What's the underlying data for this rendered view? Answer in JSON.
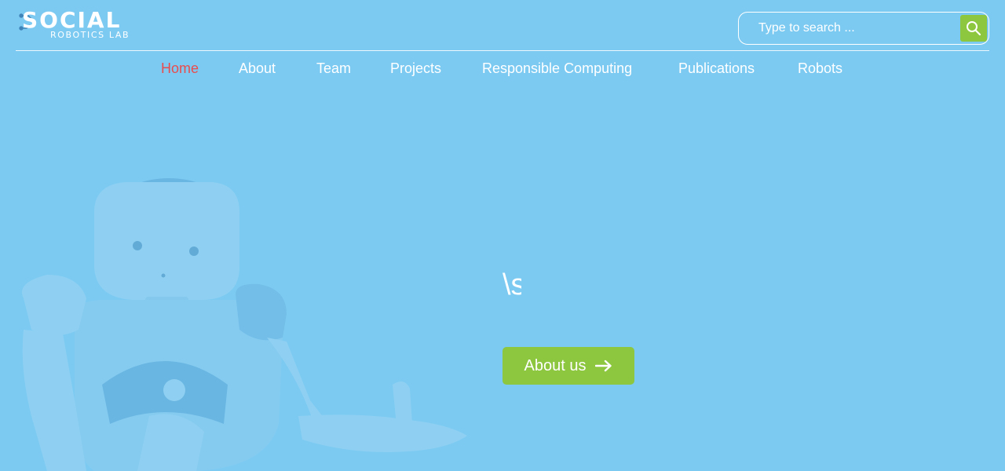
{
  "logo": {
    "main_text": "SOCIAL",
    "sub_text": "ROBOTICS LAB"
  },
  "search": {
    "placeholder": "Type to search ...",
    "value": "",
    "button_icon": "search-icon"
  },
  "nav": {
    "items": [
      {
        "label": "Home",
        "active": true
      },
      {
        "label": "About"
      },
      {
        "label": "Team"
      },
      {
        "label": "Projects"
      },
      {
        "label": "Responsible Computing"
      },
      {
        "label": "Publications"
      },
      {
        "label": "Robots"
      }
    ]
  },
  "hero": {
    "partial_heading": "\\s",
    "cta_label": "About us",
    "cta_icon": "arrow-right-icon"
  },
  "colors": {
    "background": "#7ccaf2",
    "accent": "#8dc63f",
    "active_nav": "#e94c4c",
    "text": "#ffffff"
  }
}
